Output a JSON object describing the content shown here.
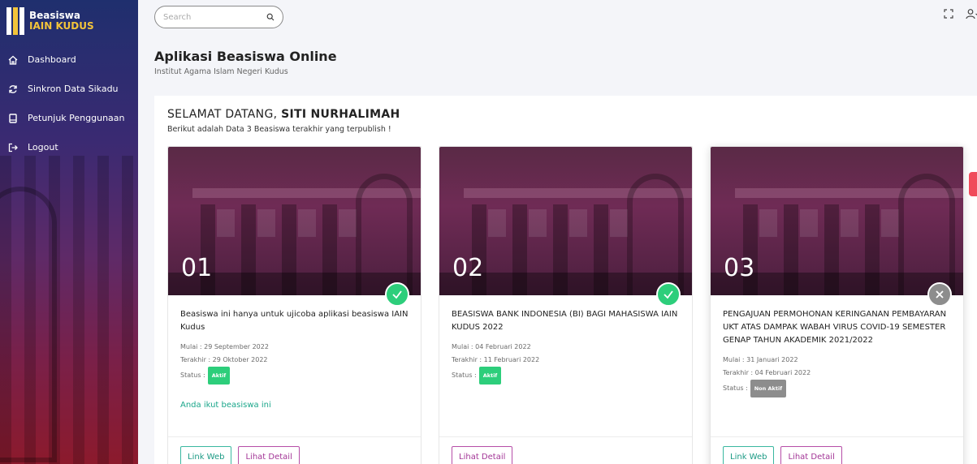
{
  "brand": {
    "line1": "Beasiswa",
    "line2": "IAIN KUDUS"
  },
  "sidebar": {
    "items": [
      {
        "label": "Dashboard",
        "icon": "home-icon"
      },
      {
        "label": "Sinkron Data Sikadu",
        "icon": "refresh-icon"
      },
      {
        "label": "Petunjuk Penggunaan",
        "icon": "book-icon"
      },
      {
        "label": "Logout",
        "icon": "logout-icon"
      }
    ]
  },
  "search": {
    "placeholder": "Search"
  },
  "page": {
    "title": "Aplikasi Beasiswa Online",
    "subtitle": "Institut Agama Islam Negeri Kudus"
  },
  "welcome": {
    "prefix": "SELAMAT DATANG, ",
    "name": "SITI NURHALIMAH",
    "sub": "Berikut adalah Data 3 Beasiswa terakhir yang terpublish !"
  },
  "cards": [
    {
      "num": "01",
      "title": "Beasiswa ini hanya untuk ujicoba aplikasi beasiswa IAIN Kudus",
      "start": "Mulai : 29 September 2022",
      "end": "Terakhir : 29 Oktober 2022",
      "status_label": "Status :",
      "status": "Aktif",
      "joined": "Anda ikut beasiswa ini",
      "link_web": "Link Web",
      "detail": "Lihat Detail"
    },
    {
      "num": "02",
      "title": "BEASISWA BANK INDONESIA (BI) BAGI MAHASISWA IAIN KUDUS 2022",
      "start": "Mulai : 04 Februari 2022",
      "end": "Terakhir : 11 Februari 2022",
      "status_label": "Status :",
      "status": "Aktif",
      "detail": "Lihat Detail"
    },
    {
      "num": "03",
      "title": "PENGAJUAN PERMOHONAN KERINGANAN PEMBAYARAN UKT ATAS DAMPAK WABAH VIRUS COVID-19 SEMESTER GENAP TAHUN AKADEMIK 2021/2022",
      "start": "Mulai : 31 Januari 2022",
      "end": "Terakhir : 04 Februari 2022",
      "status_label": "Status :",
      "status": "Non Aktif",
      "link_web": "Link Web",
      "detail": "Lihat Detail"
    }
  ],
  "colors": {
    "active": "#2dce7b",
    "inactive": "#8d8d8d",
    "link_web": "#3ab8a0",
    "detail": "#b64ea8",
    "brand_yellow": "#f3c43a"
  }
}
